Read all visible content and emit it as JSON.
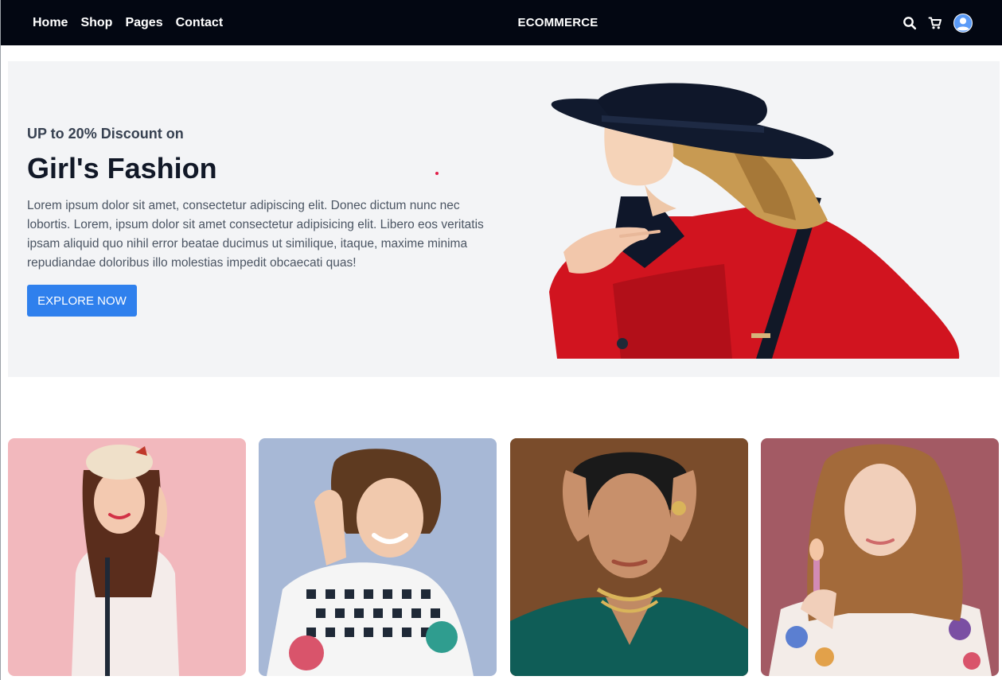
{
  "nav": {
    "links": [
      "Home",
      "Shop",
      "Pages",
      "Contact"
    ],
    "brand": "ECOMMERCE",
    "icons": [
      "search-icon",
      "cart-icon",
      "user-avatar-icon"
    ]
  },
  "hero": {
    "subtitle": "UP to 20% Discount on",
    "title": "Girl's Fashion",
    "description": "Lorem ipsum dolor sit amet, consectetur adipiscing elit. Donec dictum nunc nec lobortis. Lorem, ipsum dolor sit amet consectetur adipisicing elit. Libero eos veritatis ipsam aliquid quo nihil error beatae ducimus ut similique, itaque, maxime minima repudiandae doloribus illo molestias impedit obcaecati quas!",
    "button": "EXPLORE NOW"
  },
  "colors": {
    "navbar_bg": "#030712",
    "hero_bg": "#f3f4f6",
    "button_bg": "#2f80ed",
    "card_backgrounds": [
      "#f2b8bd",
      "#a7b8d6",
      "#6b3f24",
      "#a35a64"
    ]
  }
}
